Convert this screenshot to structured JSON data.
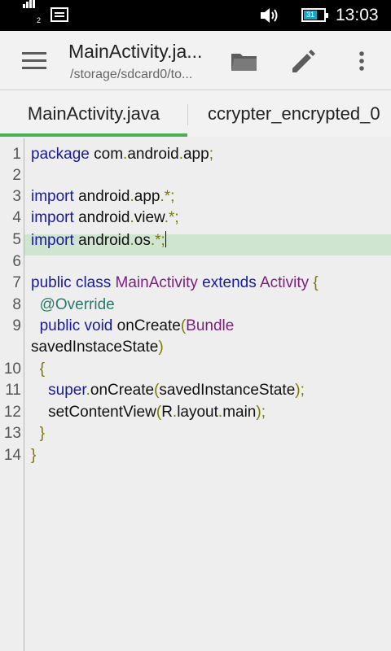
{
  "status_bar": {
    "time": "13:03",
    "sim_slot": "2",
    "battery_level": "31"
  },
  "toolbar": {
    "title": "MainActivity.ja...",
    "path": "/storage/sdcard0/to..."
  },
  "tabs": [
    {
      "label": "MainActivity.java",
      "active": true
    },
    {
      "label": "ccrypter_encrypted_0",
      "active": false
    }
  ],
  "editor": {
    "highlighted_line": 5,
    "line_numbers": [
      "1",
      "2",
      "3",
      "4",
      "5",
      "6",
      "7",
      "8",
      "9",
      "10",
      "11",
      "12",
      "13",
      "14"
    ],
    "lines": [
      {
        "tokens": [
          [
            "kw",
            "package"
          ],
          [
            "",
            " com"
          ],
          [
            "pn",
            "."
          ],
          [
            "",
            "android"
          ],
          [
            "pn",
            "."
          ],
          [
            "",
            "app"
          ],
          [
            "pn",
            ";"
          ]
        ]
      },
      {
        "tokens": []
      },
      {
        "tokens": [
          [
            "kw",
            "import"
          ],
          [
            "",
            " android"
          ],
          [
            "pn",
            "."
          ],
          [
            "",
            "app"
          ],
          [
            "pn",
            "."
          ],
          [
            "pn",
            "*"
          ],
          [
            "pn",
            ";"
          ]
        ]
      },
      {
        "tokens": [
          [
            "kw",
            "import"
          ],
          [
            "",
            " android"
          ],
          [
            "pn",
            "."
          ],
          [
            "",
            "view"
          ],
          [
            "pn",
            "."
          ],
          [
            "pn",
            "*"
          ],
          [
            "pn",
            ";"
          ]
        ]
      },
      {
        "tokens": [
          [
            "kw",
            "import"
          ],
          [
            "",
            " android"
          ],
          [
            "pn",
            "."
          ],
          [
            "",
            "os"
          ],
          [
            "pn",
            "."
          ],
          [
            "pn",
            "*"
          ],
          [
            "pn",
            ";"
          ]
        ]
      },
      {
        "tokens": []
      },
      {
        "tokens": [
          [
            "kw",
            "public"
          ],
          [
            "",
            " "
          ],
          [
            "kw",
            "class"
          ],
          [
            "",
            " "
          ],
          [
            "cls",
            "MainActivity"
          ],
          [
            "",
            " "
          ],
          [
            "kw",
            "extends"
          ],
          [
            "",
            " "
          ],
          [
            "cls",
            "Activity"
          ],
          [
            "",
            " "
          ],
          [
            "pn",
            "{"
          ]
        ]
      },
      {
        "tokens": [
          [
            "",
            "  "
          ],
          [
            "ann",
            "@Override"
          ]
        ]
      },
      {
        "tokens": [
          [
            "",
            "  "
          ],
          [
            "kw",
            "public"
          ],
          [
            "",
            " "
          ],
          [
            "kw",
            "void"
          ],
          [
            "",
            " onCreate"
          ],
          [
            "pn",
            "("
          ],
          [
            "cls",
            "Bundle"
          ]
        ]
      },
      {
        "tokens": [
          [
            "",
            "savedInstaceState"
          ],
          [
            "pn",
            ")"
          ]
        ]
      },
      {
        "tokens": [
          [
            "",
            "  "
          ],
          [
            "pn",
            "{"
          ]
        ]
      },
      {
        "tokens": [
          [
            "",
            "    "
          ],
          [
            "kw",
            "super"
          ],
          [
            "pn",
            "."
          ],
          [
            "",
            "onCreate"
          ],
          [
            "pn",
            "("
          ],
          [
            "",
            "savedInstanceState"
          ],
          [
            "pn",
            ")"
          ],
          [
            "pn",
            ";"
          ]
        ]
      },
      {
        "tokens": [
          [
            "",
            "    setContentView"
          ],
          [
            "pn",
            "("
          ],
          [
            "",
            "R"
          ],
          [
            "pn",
            "."
          ],
          [
            "",
            "layout"
          ],
          [
            "pn",
            "."
          ],
          [
            "",
            "main"
          ],
          [
            "pn",
            ")"
          ],
          [
            "pn",
            ";"
          ]
        ]
      },
      {
        "tokens": [
          [
            "",
            "  "
          ],
          [
            "pn",
            "}"
          ]
        ]
      },
      {
        "tokens": [
          [
            "pn",
            "}"
          ]
        ]
      }
    ]
  },
  "colors": {
    "accent": "#4caf50",
    "keyword": "#1a1a99",
    "class": "#7a1f7a",
    "annotation": "#2a7a6a",
    "punctuation": "#7a7a00",
    "line_highlight": "#cfe5cf"
  }
}
